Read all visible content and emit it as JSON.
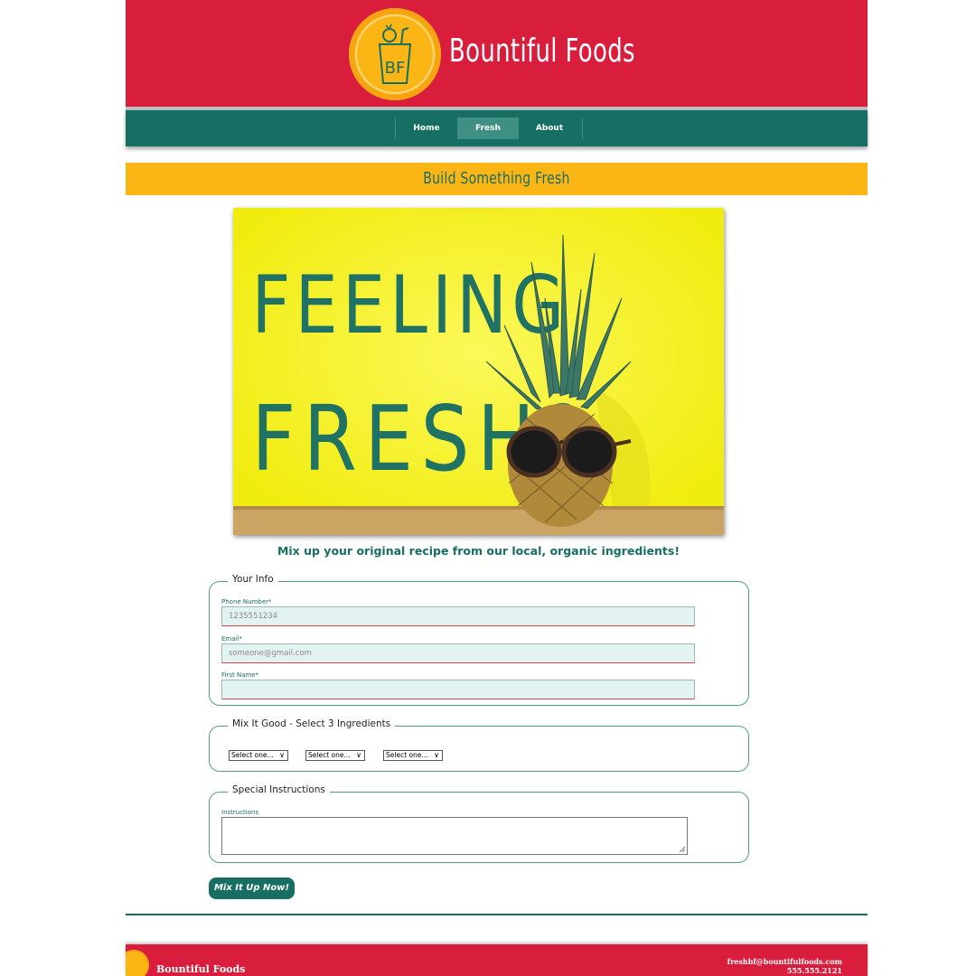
{
  "header": {
    "brand": "Bountiful Foods",
    "logo_text": "BF"
  },
  "nav": {
    "items": [
      {
        "label": "Home",
        "active": false
      },
      {
        "label": "Fresh",
        "active": true
      },
      {
        "label": "About",
        "active": false
      }
    ]
  },
  "banner": {
    "title": "Build Something Fresh"
  },
  "hero": {
    "line1": "FEELING",
    "line2": "FRESH?"
  },
  "tagline": "Mix up your original recipe from our local, organic ingredients!",
  "form": {
    "your_info": {
      "legend": "Your Info",
      "phone_label": "Phone Number*",
      "phone_placeholder": "1235551234",
      "email_label": "Email*",
      "email_placeholder": "someone@gmail.com",
      "first_name_label": "First Name*",
      "first_name_placeholder": ""
    },
    "mix": {
      "legend": "Mix It Good - Select 3 Ingredients",
      "selects": [
        "Select one...",
        "Select one...",
        "Select one..."
      ]
    },
    "special": {
      "legend": "Special Instructions",
      "instructions_label": "Instructions"
    },
    "submit_label": "Mix It Up Now!"
  },
  "footer": {
    "brand": "Bountiful Foods",
    "email": "freshbf@bountifulfoods.com",
    "phone": "555.555.2121"
  },
  "colors": {
    "red": "#d81e3c",
    "teal": "#176e62",
    "gold": "#fbb515",
    "yellow": "#f4f01c"
  }
}
